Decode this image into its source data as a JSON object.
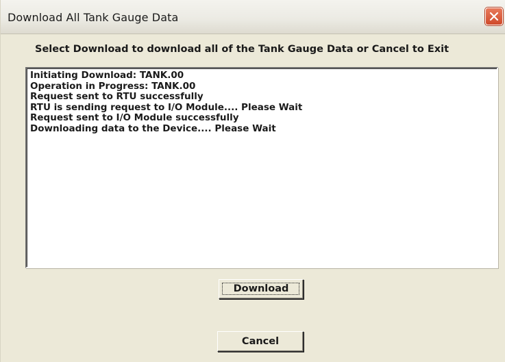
{
  "window": {
    "title": "Download All Tank Gauge Data",
    "close_icon": "close-icon"
  },
  "prompt": {
    "text": "Select Download to download all of the Tank Gauge Data or Cancel to Exit"
  },
  "log": {
    "lines": [
      "Initiating Download: TANK.00",
      "Operation in Progress: TANK.00",
      "Request sent to RTU successfully",
      "RTU is sending request to I/O Module.... Please Wait",
      "Request sent to I/O Module successfully",
      "Downloading data to the Device.... Please Wait"
    ]
  },
  "buttons": {
    "download_label": "Download",
    "cancel_label": "Cancel"
  },
  "colors": {
    "dialog_background": "#ece9d8",
    "close_button": "#cf4a2a"
  }
}
